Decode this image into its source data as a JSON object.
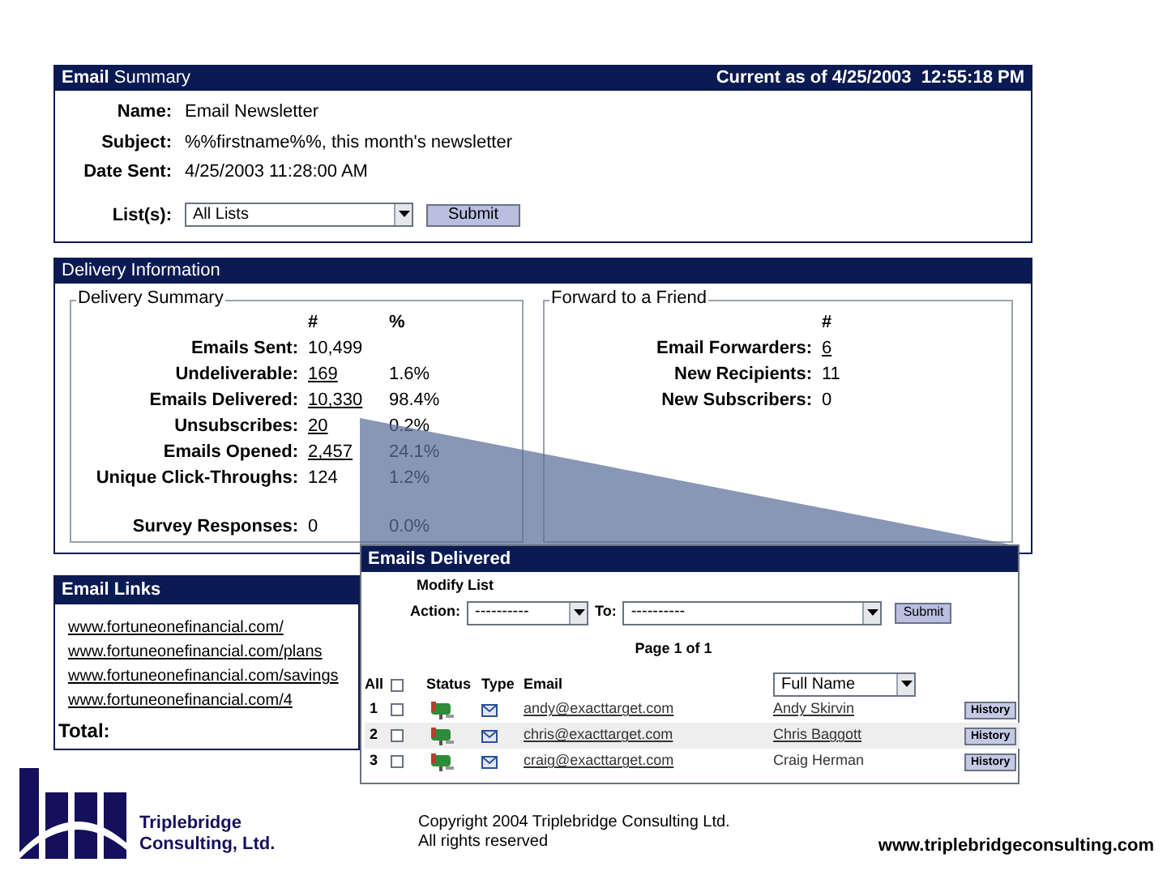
{
  "email_summary": {
    "title": "**Email** Summary",
    "current_as_of": "Current as of 4/25/2003  12:55:18 PM",
    "fields": [
      {
        "label": "Name:",
        "value": "Email Newsletter"
      },
      {
        "label": "Subject:",
        "value": "%%firstname%%, this month's newsletter"
      },
      {
        "label": "Date Sent:",
        "value": "4/25/2003 11:28:00 AM"
      }
    ],
    "lists": {
      "label": "List(s):",
      "value": "All Lists"
    },
    "submit": "Submit"
  },
  "delivery_information": {
    "title": "Delivery Information",
    "delivery_summary": {
      "legend": "Delivery Summary",
      "count_heading": "#",
      "percent_heading": "%",
      "rows": [
        {
          "label": "Emails Sent:",
          "count": "10,499",
          "linked": false
        },
        {
          "label": "Undeliverable:",
          "count": "169",
          "percent": "1.6%",
          "linked": true
        },
        {
          "label": "Emails Delivered:",
          "count": "10,330",
          "percent": "98.4%",
          "linked": true
        },
        {
          "label": "Unsubscribes:",
          "count": "20",
          "percent": "0.2%",
          "linked": true
        },
        {
          "label": "Emails Opened:",
          "count": "2,457",
          "percent": "24.1%",
          "linked": true
        },
        {
          "label": "Unique Click-Throughs:",
          "count": "124",
          "percent": "1.2%",
          "linked": false
        }
      ],
      "survey_rows": [
        {
          "label": "Survey Responses:",
          "count": "0",
          "percent": "0.0%",
          "linked": false
        }
      ]
    },
    "forward_to_a_friend": {
      "legend": "Forward to a Friend",
      "count_heading": "#",
      "rows": [
        {
          "label": "Email Forwarders:",
          "count": "6",
          "linked": true
        },
        {
          "label": "New Recipients:",
          "count": "11",
          "linked": false
        },
        {
          "label": "New Subscribers:",
          "count": "0",
          "linked": false
        }
      ]
    }
  },
  "email_links": {
    "title": "Email Links",
    "links": [
      "www.fortuneonefinancial.com/",
      "www.fortuneonefinancial.com/plans",
      "www.fortuneonefinancial.com/savings",
      "www.fortuneonefinancial.com/4"
    ],
    "total": "Total:"
  },
  "emails_delivered": {
    "title": "Emails Delivered",
    "modify_list": "Modify List",
    "action": {
      "label": "Action:",
      "value": "----------"
    },
    "to": {
      "label": "To:",
      "value": "----------"
    },
    "submit": "Submit",
    "page": "Page 1 of 1",
    "columns": {
      "all": "All",
      "all_checked": false,
      "status": "Status",
      "type": "Type",
      "email": "Email",
      "name_select": "Full Name"
    },
    "rows": [
      {
        "number": "1",
        "checked": false,
        "email": "andy@exacttarget.com",
        "name": "Andy Skirvin",
        "name_linked": true,
        "action": "History"
      },
      {
        "number": "2",
        "checked": false,
        "email": "chris@exacttarget.com",
        "name": "Chris Baggott",
        "name_linked": true,
        "action": "History"
      },
      {
        "number": "3",
        "checked": false,
        "email": "craig@exacttarget.com",
        "name": "Craig Herman",
        "name_linked": false,
        "action": "History"
      }
    ]
  },
  "footer": {
    "company": "Triplebridge",
    "company_line2": "Consulting, Ltd.",
    "copyright": "Copyright 2004 Triplebridge Consulting Ltd.",
    "rights": "All rights reserved",
    "website": "www.triplebridgeconsulting.com"
  }
}
